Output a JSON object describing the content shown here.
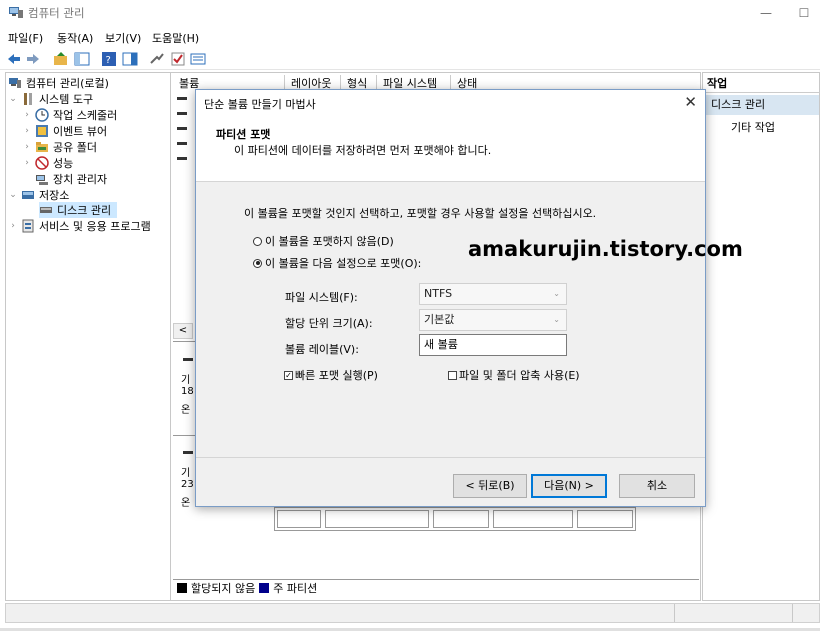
{
  "window": {
    "title": "컴퓨터 관리",
    "minimize": "—",
    "maximize": "☐"
  },
  "menu": [
    "파일(F)",
    "동작(A)",
    "보기(V)",
    "도움말(H)"
  ],
  "tree": {
    "root": "컴퓨터 관리(로컬)",
    "system_tools": "시스템 도구",
    "task_scheduler": "작업 스케줄러",
    "event_viewer": "이벤트 뷰어",
    "shared_folders": "공유 폴더",
    "performance": "성능",
    "device_manager": "장치 관리자",
    "storage": "저장소",
    "disk_management": "디스크 관리",
    "services": "서비스 및 응용 프로그램"
  },
  "center": {
    "columns": [
      "볼륨",
      "레이아웃",
      "형식",
      "파일 시스템",
      "상태"
    ],
    "disk_rows": [
      {
        "line1": "기",
        "line2": "18",
        "line3": "온"
      },
      {
        "line1": "기",
        "line2": "23",
        "line3": "온"
      }
    ],
    "scroll_left": "<",
    "legend_unallocated": "할당되지 않음",
    "legend_primary": "주 파티션",
    "colors": {
      "unallocated": "#000000",
      "primary": "#00008b"
    }
  },
  "actions": {
    "header": "작업",
    "selected": "디스크 관리",
    "more": "기타 작업"
  },
  "dialog": {
    "title": "단순 볼륨 만들기 마법사",
    "close": "✕",
    "header_title": "파티션 포맷",
    "header_desc": "이 파티션에 데이터를 저장하려면 먼저 포맷해야 합니다.",
    "instruction": "이 볼륨을 포맷할 것인지 선택하고, 포맷할 경우 사용할 설정을 선택하십시오.",
    "radio_no_format": "이 볼륨을 포맷하지 않음(D)",
    "radio_format": "이 볼륨을 다음 설정으로 포맷(O):",
    "fs_label": "파일 시스템(F):",
    "fs_value": "NTFS",
    "alloc_label": "할당 단위 크기(A):",
    "alloc_value": "기본값",
    "vol_label": "볼륨 레이블(V):",
    "vol_value": "새 볼륨",
    "quick_format": "빠른 포맷 실행(P)",
    "compress": "파일 및 폴더 압축 사용(E)",
    "back": "< 뒤로(B)",
    "next": "다음(N) >",
    "cancel": "취소"
  },
  "watermark": "amakurujin.tistory.com"
}
